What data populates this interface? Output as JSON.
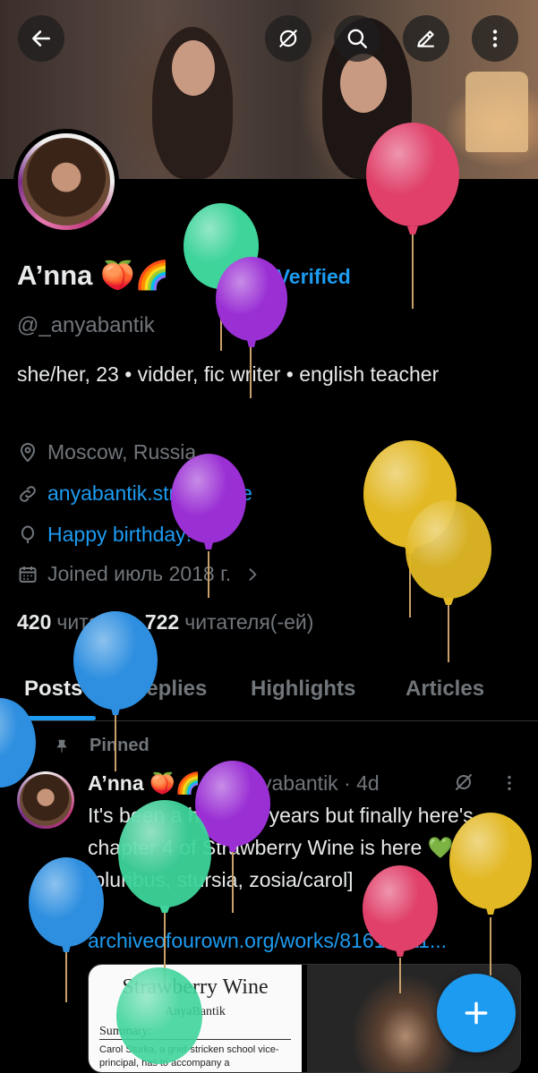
{
  "profile": {
    "name": "A’nna 🍑🌈",
    "verified_label": "Get Verified",
    "handle": "@_anyabantik",
    "bio": "she/her, 23 • vidder, fic writer • english teacher",
    "location": "Moscow, Russia",
    "website": "anyabantik.straw.page",
    "birthday": "Happy birthday!",
    "joined": "Joined июль 2018 г.",
    "following_count": "420",
    "following_label": "читает",
    "followers_count": "722",
    "followers_label": "читателя(-ей)"
  },
  "header": {
    "back_icon": "arrow-left-icon",
    "grok_icon": "grok-icon",
    "search_icon": "search-icon",
    "edit_icon": "edit-icon",
    "more_icon": "more-vertical-icon"
  },
  "tabs": [
    {
      "label": "Posts",
      "active": true
    },
    {
      "label": "Replies"
    },
    {
      "label": "Highlights"
    },
    {
      "label": "Articles"
    }
  ],
  "post": {
    "pinned_label": "Pinned",
    "author": "A’nna 🍑🌈",
    "meta": "@_anyabantik · 4d",
    "text": "It's been a hundred years but finally here's chapter 4 of Strawberry Wine is here 💚 [pluribus, stursia, zosia/carol]",
    "link": "archiveofourown.org/works/81610411...",
    "card": {
      "title": "Strawberry Wine",
      "author": "AnyaBantik",
      "summary_label": "Summary:",
      "summary": "Carol Sturka, a grief-stricken school vice-principal, has to accompany a"
    }
  },
  "fab": {
    "icon": "plus-icon"
  },
  "colors": {
    "accent": "#1d9bf0",
    "background": "#000000",
    "text": "#e7e9ea",
    "muted": "#71767b",
    "balloon_pink": "#e0406a",
    "balloon_green": "#3ed49a",
    "balloon_purple": "#9a2fd4",
    "balloon_yellow": "#e2b824",
    "balloon_blue": "#2e8fe0"
  }
}
